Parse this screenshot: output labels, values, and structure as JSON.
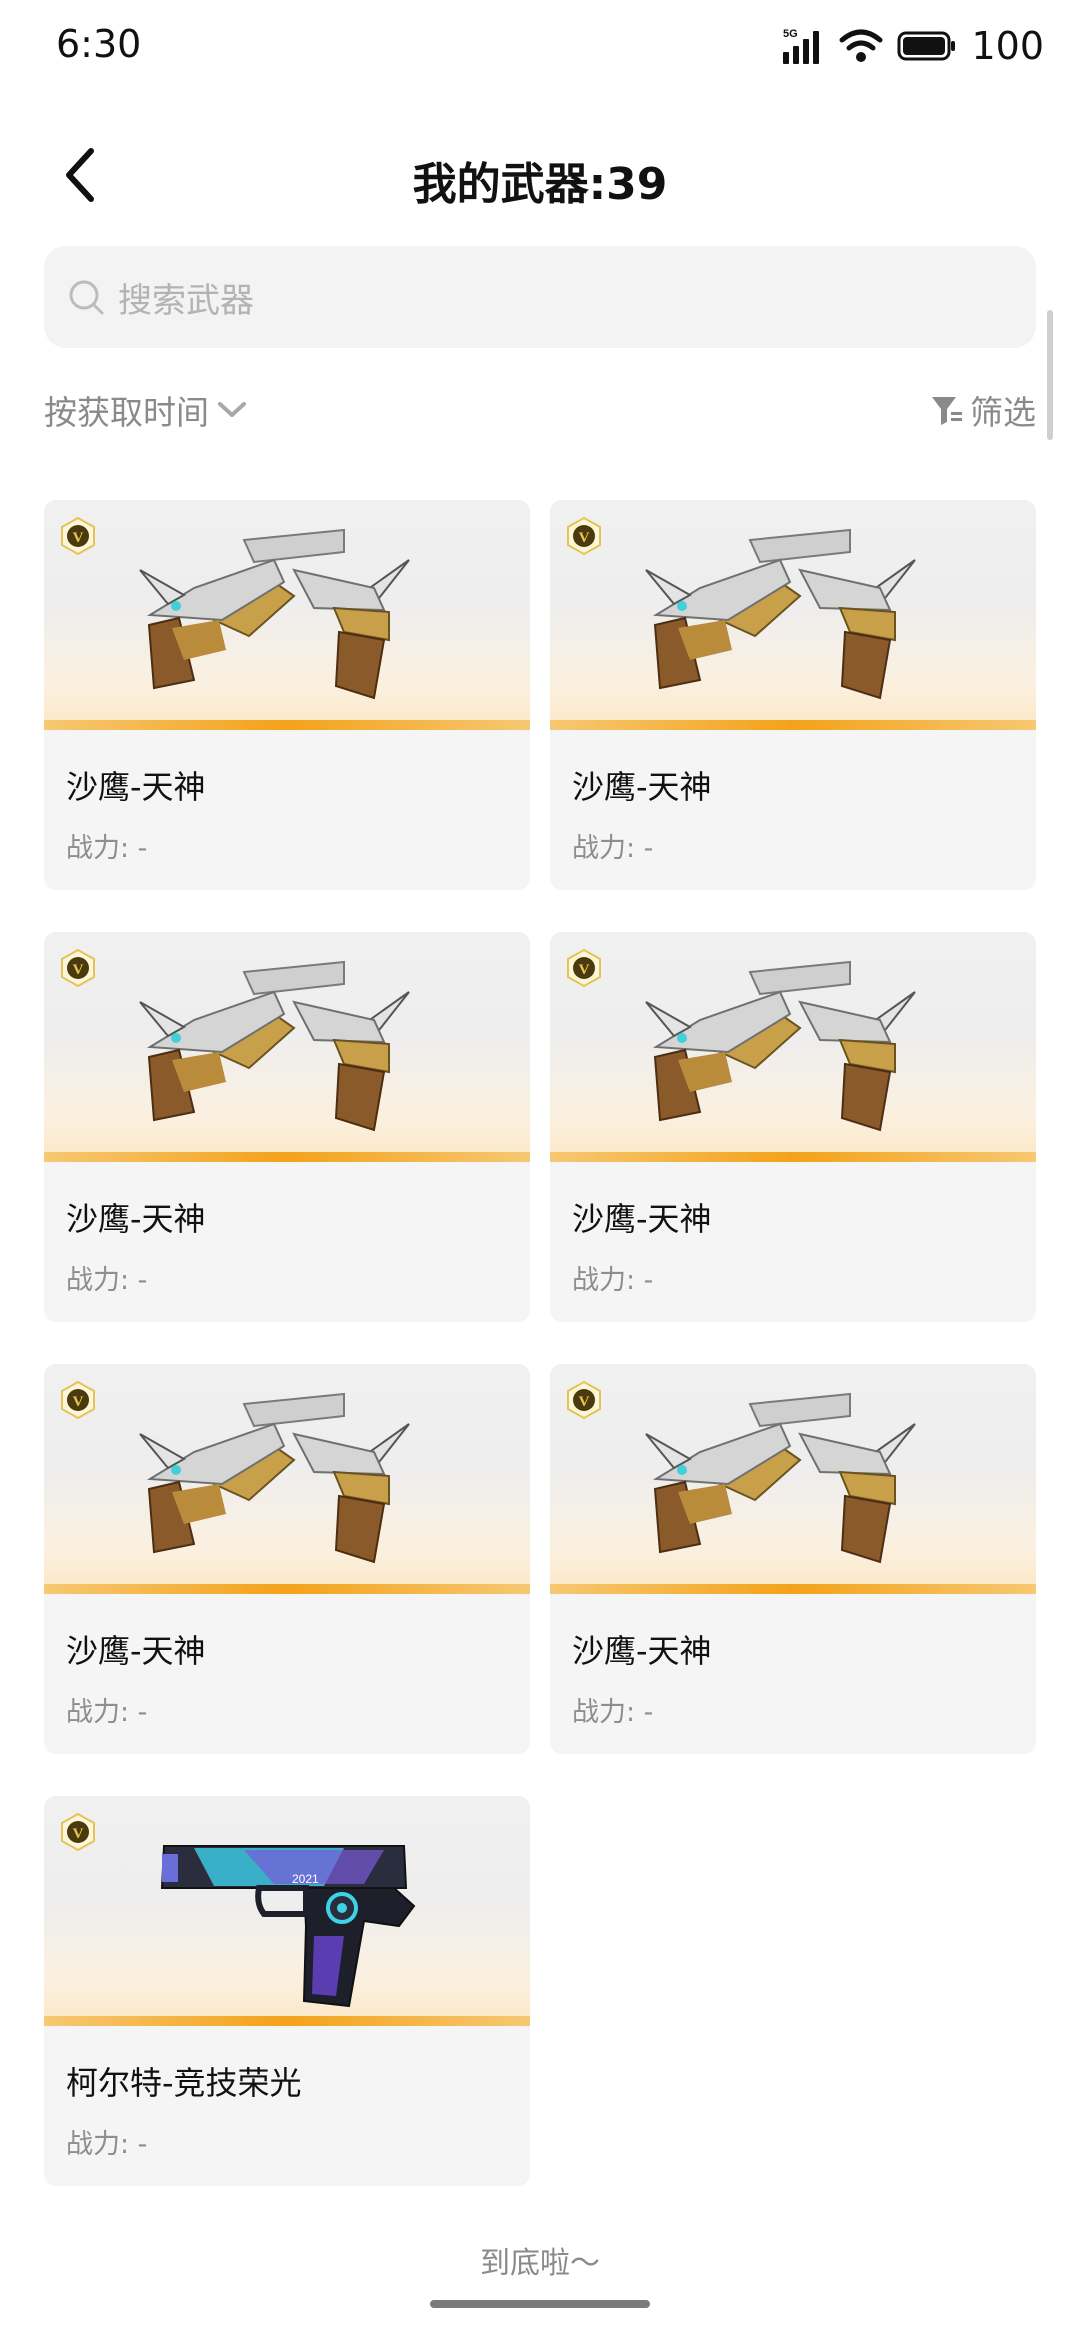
{
  "status": {
    "time": "6:30",
    "network": "5G",
    "battery": "100"
  },
  "header": {
    "title": "我的武器:39"
  },
  "search": {
    "placeholder": "搜索武器"
  },
  "sort": {
    "label": "按获取时间"
  },
  "filter": {
    "label": "筛选"
  },
  "weapons": [
    {
      "name": "沙鹰-天神",
      "power": "战力: -",
      "badge": "V",
      "art": "deagle-twin-icon"
    },
    {
      "name": "沙鹰-天神",
      "power": "战力: -",
      "badge": "V",
      "art": "deagle-twin-icon"
    },
    {
      "name": "沙鹰-天神",
      "power": "战力: -",
      "badge": "V",
      "art": "deagle-twin-icon"
    },
    {
      "name": "沙鹰-天神",
      "power": "战力: -",
      "badge": "V",
      "art": "deagle-twin-icon"
    },
    {
      "name": "沙鹰-天神",
      "power": "战力: -",
      "badge": "V",
      "art": "deagle-twin-icon"
    },
    {
      "name": "沙鹰-天神",
      "power": "战力: -",
      "badge": "V",
      "art": "deagle-twin-icon"
    },
    {
      "name": "柯尔特-竞技荣光",
      "power": "战力: -",
      "badge": "V",
      "art": "colt-pistol-icon",
      "engraving": "2021"
    }
  ],
  "footer": {
    "text": "到底啦～"
  },
  "colors": {
    "accent": "#f4a21a",
    "badge_gold": "#c9a22a",
    "muted_text": "#8a8a8a"
  }
}
